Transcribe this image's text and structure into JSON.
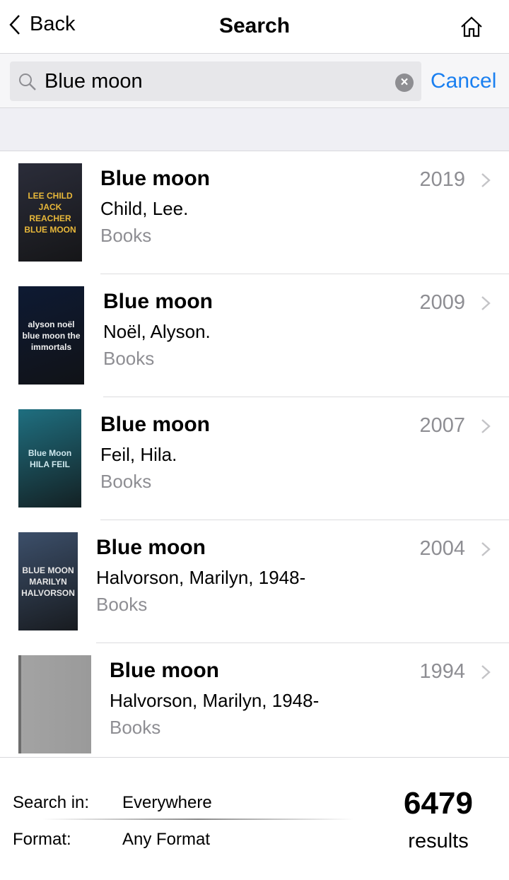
{
  "nav": {
    "back_label": "Back",
    "title": "Search"
  },
  "search": {
    "value": "Blue moon",
    "cancel_label": "Cancel"
  },
  "results": [
    {
      "title": "Blue moon",
      "author": "Child, Lee.",
      "format": "Books",
      "year": "2019",
      "cover_color": "#2b2d3a",
      "cover_text": "LEE CHILD JACK REACHER BLUE MOON"
    },
    {
      "title": "Blue moon",
      "author": "Noël, Alyson.",
      "format": "Books",
      "year": "2009",
      "cover_color": "#0e1a33",
      "cover_text": "alyson noël blue moon the immortals"
    },
    {
      "title": "Blue moon",
      "author": "Feil, Hila.",
      "format": "Books",
      "year": "2007",
      "cover_color": "#1f6f80",
      "cover_text": "Blue Moon HILA FEIL"
    },
    {
      "title": "Blue moon",
      "author": "Halvorson, Marilyn, 1948-",
      "format": "Books",
      "year": "2004",
      "cover_color": "#3c4f6a",
      "cover_text": "BLUE MOON MARILYN HALVORSON"
    },
    {
      "title": "Blue moon",
      "author": "Halvorson, Marilyn, 1948-",
      "format": "Books",
      "year": "1994",
      "cover_color": "#9a9a9a"
    }
  ],
  "footer": {
    "search_in_label": "Search in:",
    "search_in_value": "Everywhere",
    "format_label": "Format:",
    "format_value": "Any Format",
    "count": "6479",
    "count_label": "results"
  }
}
